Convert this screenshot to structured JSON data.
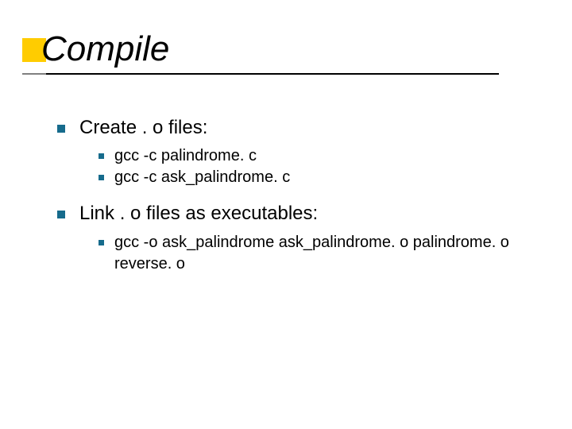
{
  "title": "Compile",
  "items": [
    {
      "text": "Create . o files:",
      "sub": [
        "gcc -c palindrome. c",
        "gcc -c ask_palindrome. c"
      ]
    },
    {
      "text": "Link . o files as executables:",
      "sub": [
        "gcc -o ask_palindrome ask_palindrome. o palindrome. o reverse. o"
      ]
    }
  ]
}
